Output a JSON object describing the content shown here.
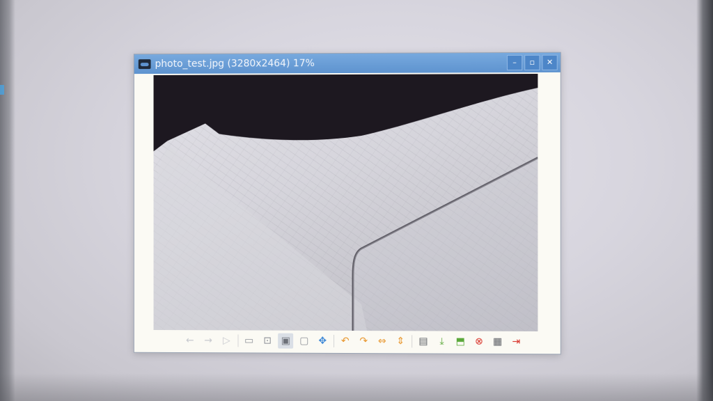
{
  "window": {
    "title": "photo_test.jpg (3280x2464) 17%",
    "buttons": {
      "minimize": "–",
      "maximize": "▫",
      "close": "✕"
    }
  },
  "toolbar": {
    "items": [
      {
        "name": "previous-image",
        "glyph": "←",
        "state": "disabled"
      },
      {
        "name": "next-image",
        "glyph": "→",
        "state": "disabled"
      },
      {
        "name": "slideshow",
        "glyph": "▷",
        "state": "disabled"
      },
      {
        "name": "zoom-out",
        "glyph": "▭",
        "state": "grey"
      },
      {
        "name": "fit-window",
        "glyph": "⊡",
        "state": "grey"
      },
      {
        "name": "actual-size",
        "glyph": "▣",
        "state": "active"
      },
      {
        "name": "zoom-in",
        "glyph": "▢",
        "state": "grey"
      },
      {
        "name": "fullscreen",
        "glyph": "✥",
        "state": "blue"
      },
      {
        "name": "rotate-left",
        "glyph": "↶",
        "state": "orange"
      },
      {
        "name": "rotate-right",
        "glyph": "↷",
        "state": "orange"
      },
      {
        "name": "flip-horizontal",
        "glyph": "⇔",
        "state": "orange"
      },
      {
        "name": "flip-vertical",
        "glyph": "⇕",
        "state": "orange"
      },
      {
        "name": "open-file",
        "glyph": "▤",
        "state": "dark"
      },
      {
        "name": "save-file",
        "glyph": "⤓",
        "state": "green"
      },
      {
        "name": "save-as",
        "glyph": "⬒",
        "state": "green"
      },
      {
        "name": "delete-file",
        "glyph": "⊗",
        "state": "red"
      },
      {
        "name": "preferences",
        "glyph": "▦",
        "state": "dark"
      },
      {
        "name": "quit",
        "glyph": "⇥",
        "state": "red"
      }
    ]
  }
}
